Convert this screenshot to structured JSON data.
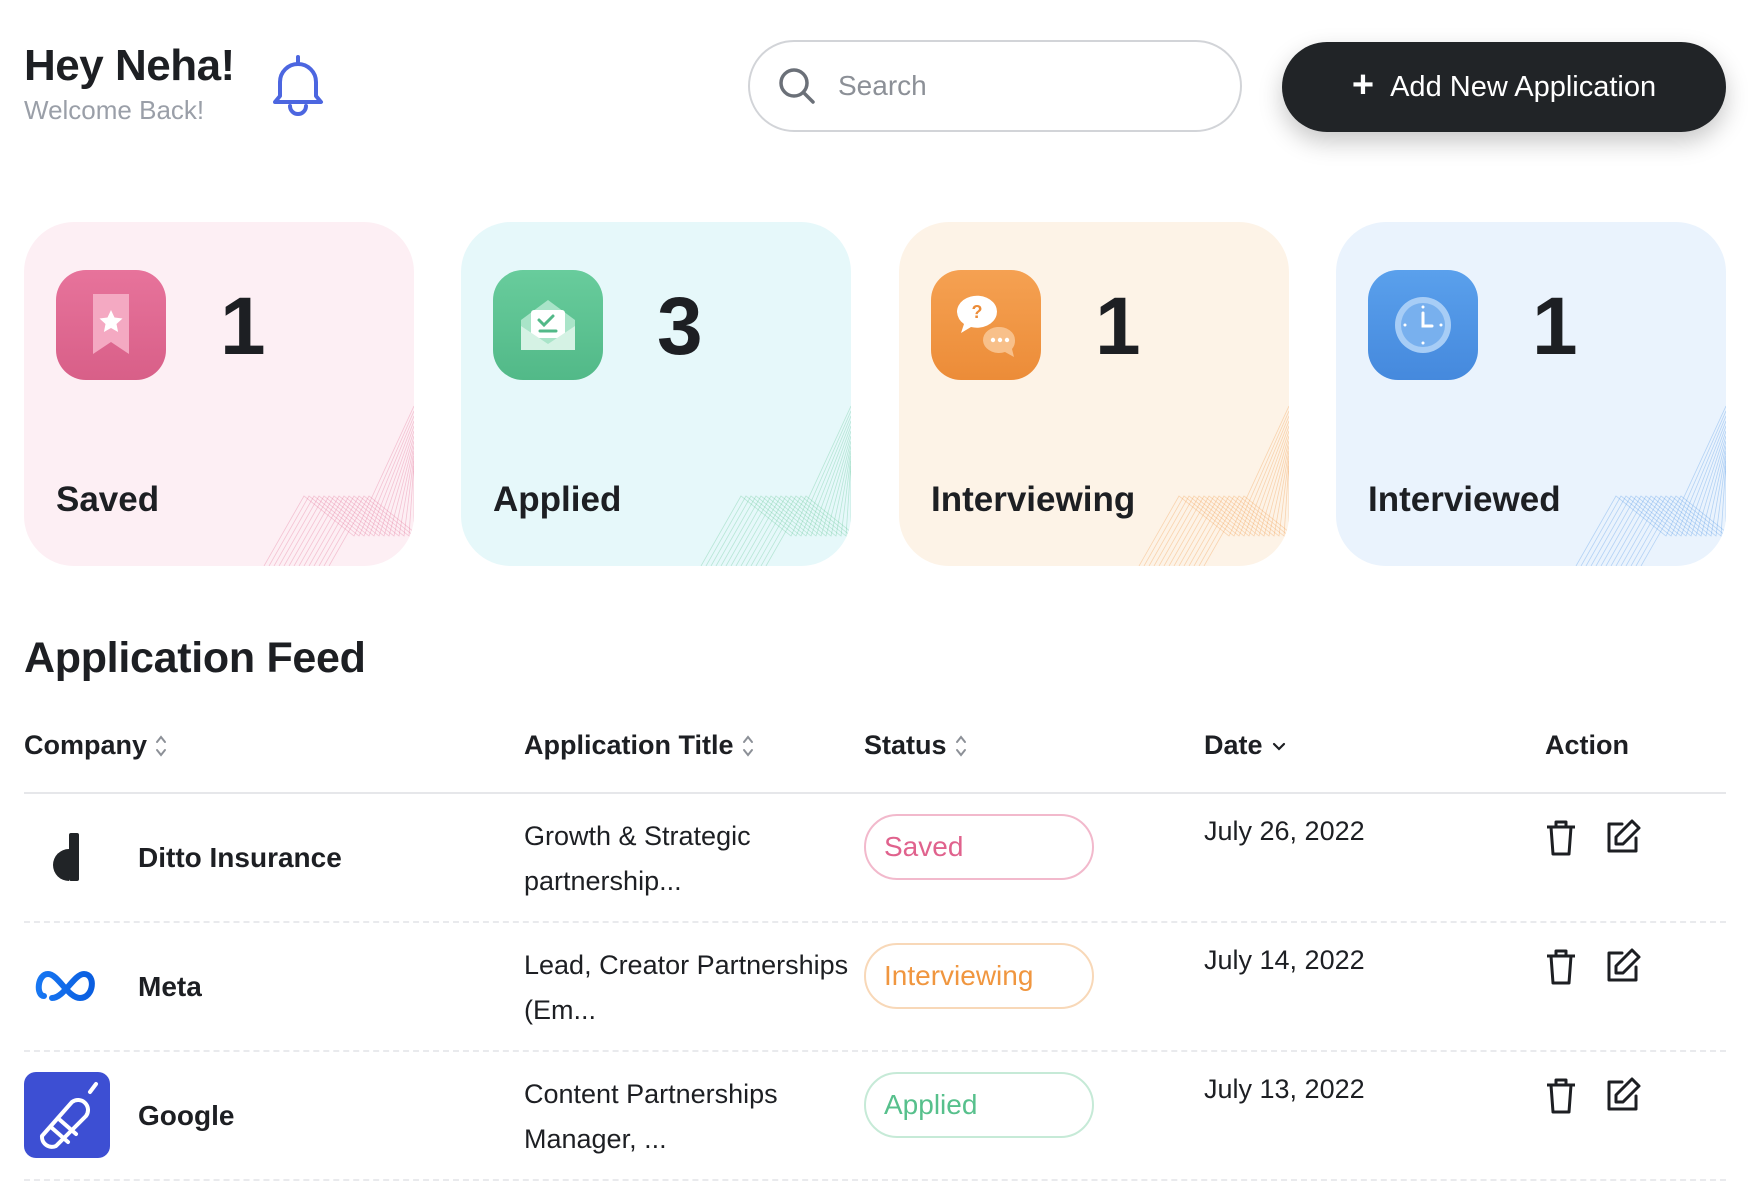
{
  "header": {
    "greeting": "Hey Neha!",
    "welcome": "Welcome Back!",
    "search_placeholder": "Search",
    "add_button_label": "Add New Application"
  },
  "stats": [
    {
      "label": "Saved",
      "count": "1",
      "icon": "bookmark-star-icon",
      "color": "#e16f95",
      "bg": "#fdeff4"
    },
    {
      "label": "Applied",
      "count": "3",
      "icon": "envelope-check-icon",
      "color": "#5ec593",
      "bg": "#e6f8fa"
    },
    {
      "label": "Interviewing",
      "count": "1",
      "icon": "chat-bubbles-icon",
      "color": "#f19745",
      "bg": "#fdf3e7"
    },
    {
      "label": "Interviewed",
      "count": "1",
      "icon": "clock-icon",
      "color": "#4d94e6",
      "bg": "#eaf3fd"
    }
  ],
  "feed": {
    "title": "Application Feed",
    "columns": {
      "company": "Company",
      "title": "Application Title",
      "status": "Status",
      "date": "Date",
      "action": "Action"
    },
    "rows": [
      {
        "company": "Ditto Insurance",
        "title": "Growth & Strategic partnership...",
        "status": "Saved",
        "date": "July 26, 2022",
        "logo": "ditto-logo"
      },
      {
        "company": "Meta",
        "title": "Lead, Creator Partnerships (Em...",
        "status": "Interviewing",
        "date": "July 14, 2022",
        "logo": "meta-logo"
      },
      {
        "company": "Google",
        "title": "Content Partnerships Manager, ...",
        "status": "Applied",
        "date": "July 13, 2022",
        "logo": "google-app-logo"
      }
    ]
  },
  "colors": {
    "saved": "#e0628d",
    "interviewing": "#f0963f",
    "applied": "#57c08c",
    "primary_button": "#212427",
    "bell": "#4c66e0"
  }
}
